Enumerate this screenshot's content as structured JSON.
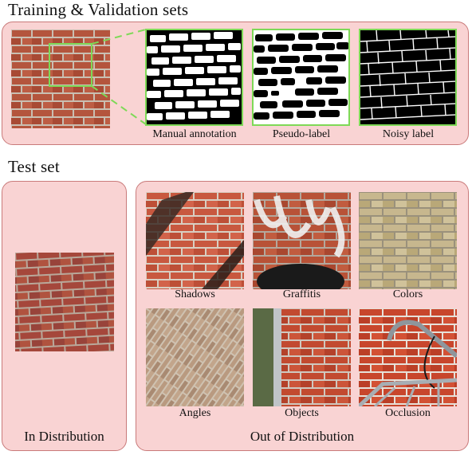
{
  "titles": {
    "train_val": "Training & Validation sets",
    "test": "Test set"
  },
  "train_val_panel": {
    "captions": [
      "Manual annotation",
      "Pseudo-label",
      "Noisy label"
    ]
  },
  "test_panel": {
    "in_distribution": "In Distribution",
    "out_of_distribution": "Out of Distribution",
    "ood_captions": [
      "Shadows",
      "Graffitis",
      "Colors",
      "Angles",
      "Objects",
      "Occlusion"
    ]
  },
  "colors": {
    "panel_fill": "#f9d3d3",
    "panel_border": "#c97a7a",
    "highlight": "#7ed957",
    "brick_red": "#b5553d",
    "mortar": "#c9bfb2"
  }
}
